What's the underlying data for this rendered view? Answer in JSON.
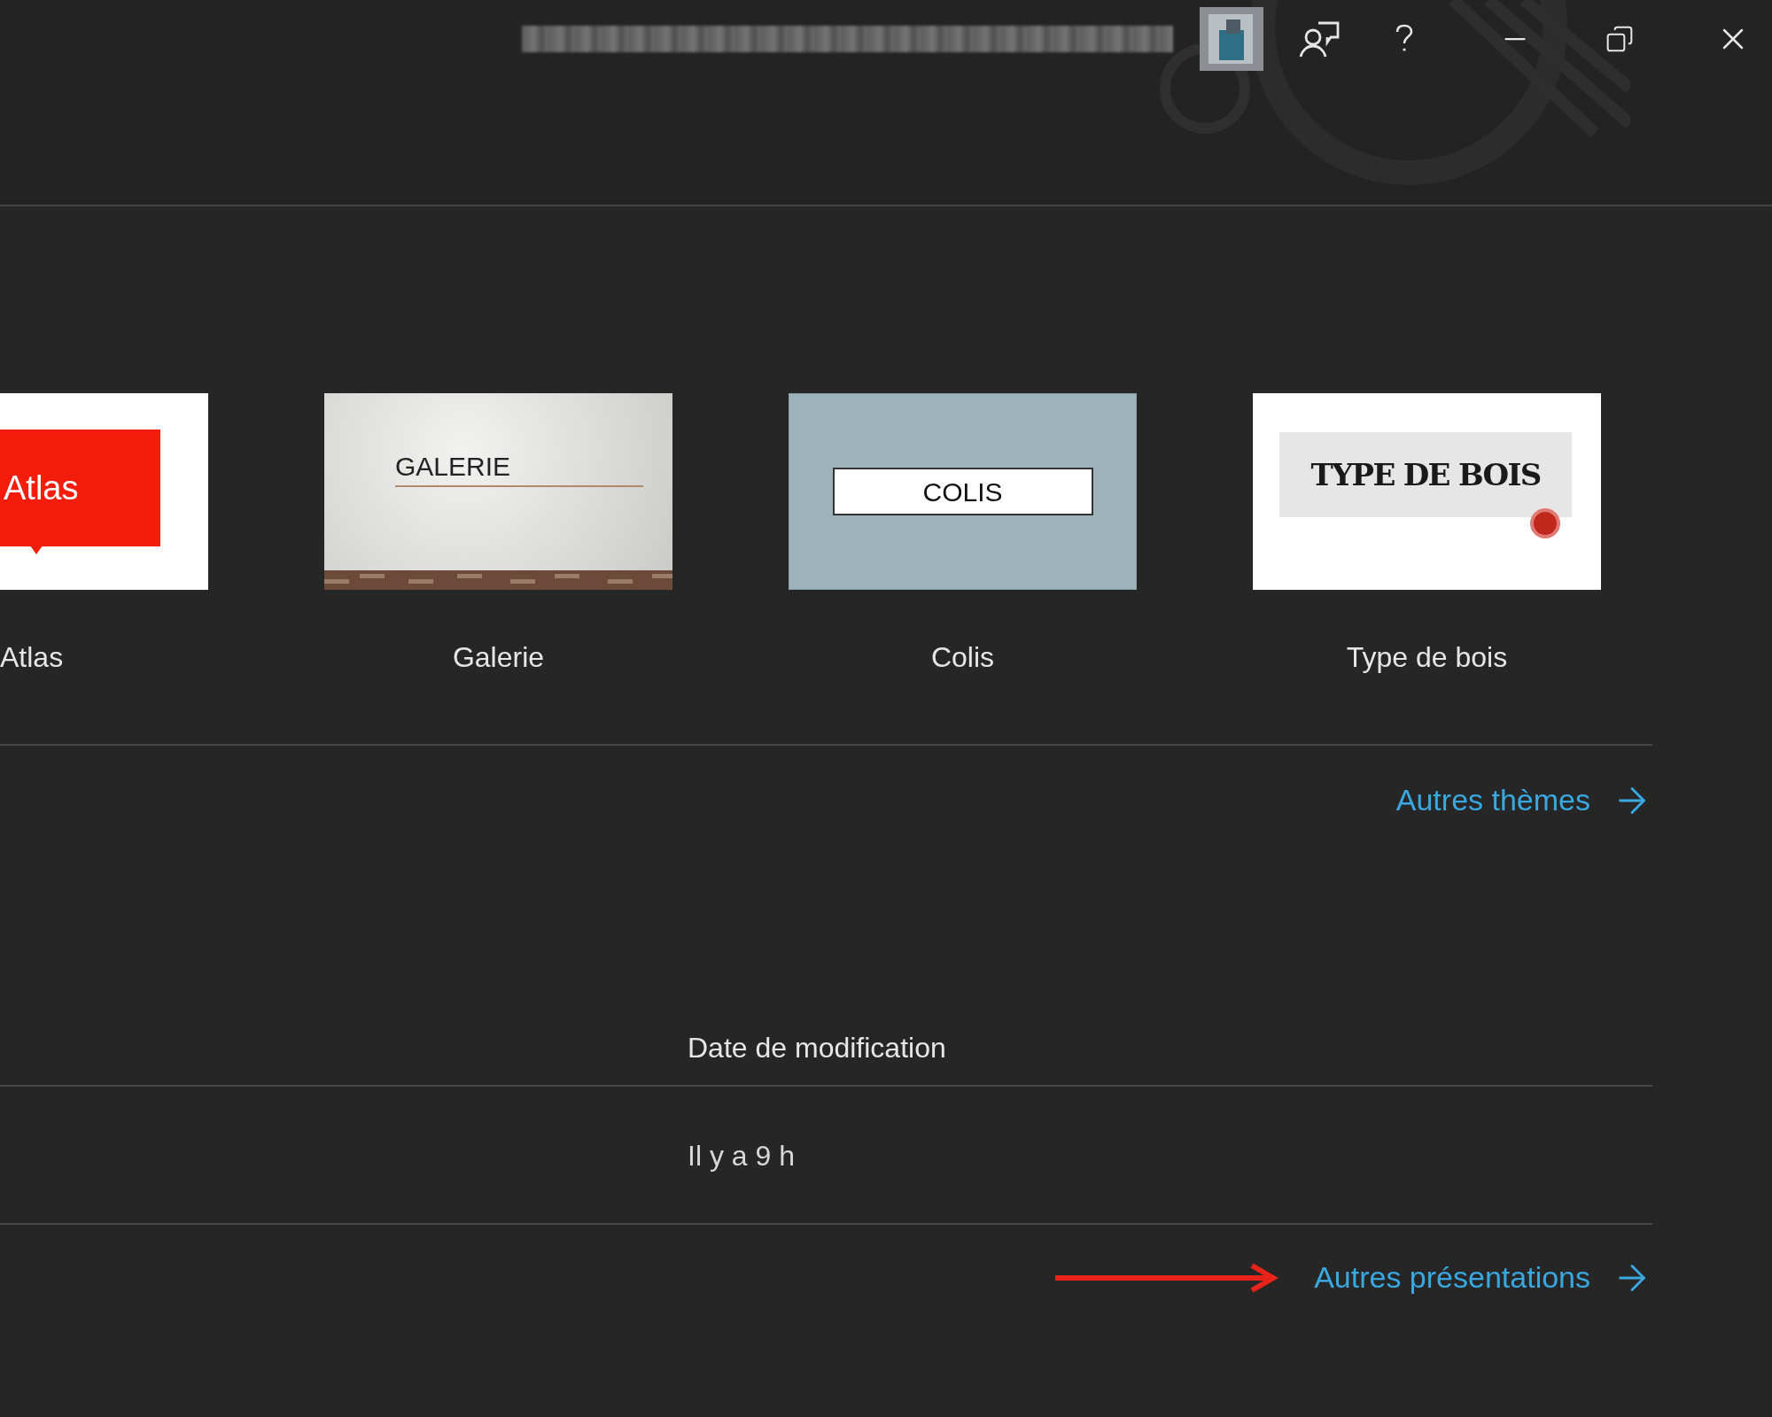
{
  "themes": [
    {
      "kind": "atlas",
      "name": "Atlas",
      "thumbnail_text": "Atlas"
    },
    {
      "kind": "gallery",
      "name": "Galerie",
      "thumbnail_text": "GALERIE"
    },
    {
      "kind": "parcel",
      "name": "Colis",
      "thumbnail_text": "COLIS"
    },
    {
      "kind": "wood",
      "name": "Type de bois",
      "thumbnail_text": "TYPE DE BOIS"
    }
  ],
  "more_themes_link": "Autres thèmes",
  "recent": {
    "columns": [
      "Date de modification"
    ],
    "rows": [
      [
        "Il y a 9 h"
      ]
    ]
  },
  "more_presentations_link": "Autres présentations"
}
